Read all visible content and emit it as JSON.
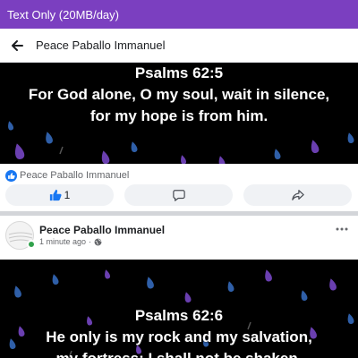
{
  "status_bar": {
    "data_mode": "Text Only (20MB/day)"
  },
  "top_bar": {
    "title": "Peace Paballo Immanuel"
  },
  "post1": {
    "verse_ref": "Psalms 62:5",
    "verse_line1": "For God alone, O my soul, wait in silence,",
    "verse_line2": "for my hope is from him.",
    "author": "Peace Paballo Immanuel",
    "like_count": "1"
  },
  "post2": {
    "author": "Peace Paballo Immanuel",
    "time": "1 minute ago",
    "separator": "·",
    "verse_ref": "Psalms 62:6",
    "verse_line1": "He only is my rock and my salvation,",
    "verse_line2": "my fortress; I shall not be shaken."
  },
  "icons": {
    "back": "arrow-left-icon",
    "like": "thumbs-up-icon",
    "comment": "comment-icon",
    "share": "share-icon",
    "globe": "globe-icon",
    "more": "more-horizontal-icon"
  },
  "colors": {
    "status_bar": "#7b3fc0",
    "like_blue": "#1877f2",
    "drop_purple": "#6a3fb0",
    "drop_blue": "#2f5fa8",
    "online_green": "#31a24c"
  }
}
